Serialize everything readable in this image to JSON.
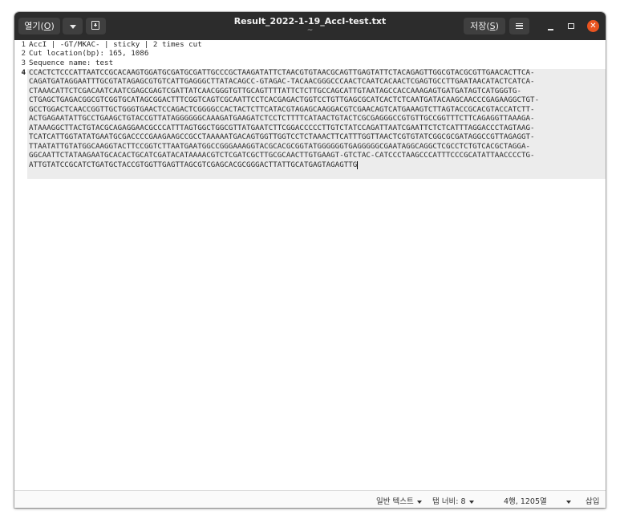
{
  "titlebar": {
    "open_label": "열기(",
    "open_key": "O",
    "open_close": ")",
    "title": "Result_2022-1-19_AccI-test.txt",
    "subtitle": "~",
    "save_label": "저장(",
    "save_key": "S",
    "save_close": ")"
  },
  "editor": {
    "line_numbers": [
      "1",
      "2",
      "3",
      "4"
    ],
    "lines": [
      "AccI | -GT/MKAC- | sticky | 2 times cut",
      "Cut location(bp): 165, 1086",
      "Sequence name: test",
      "CCACTCTCCCATTAATCCGCACAAGTGGATGCGATGCGATTGCCCGCTAAGATATTCTAACGTGTAACGCAGTTGAGTATTCTACAGAGTTGGCGTACGCGTTGAACACTTCA-",
      "CAGATGATAGGAATTTGCGTATAGAGCGTGTCATTGAGGGCTTATACAGCC-GTAGAC-TACAACGGGCCCAACTCAATCACAACTCGAGTGCCTTGAATAACATACTCATCA-",
      "CTAAACATTCTCGACAATCAATCGAGCGAGTCGATTATCAACGGGTGTTGCAGTTTTATTCTCTTGCCAGCATTGTAATAGCCACCAAAGAGTGATGATAGTCATGGGTG-",
      "CTGAGCTGAGACGGCGTCGGTGCATAGCGGACTTTCGGTCAGTCGCAATTCCTCACGAGACTGGTCCTGTTGAGCGCATCACTCTCAATGATACAAGCAACCCGAGAAGGCTGT-",
      "GCCTGGACTCAACCGGTTGCTGGGTGAACTCCAGACTCGGGGCCACTACTCTTCATACGTAGAGCAAGGACGTCGAACAGTCATGAAAGTCTTAGTACCGCACGTACCATCTT-",
      "ACTGAGAATATTGCCTGAAGCTGTACCGTTATAGGGGGGCAAAGATGAAGATCTCCTCTTTTCATAACTGTACTCGCGAGGGCCGTGTTGCCGGTTTCTTCAGAGGTTAAAGA-",
      "ATAAAGGCTTACTGTACGCAGAGGAACGCCCATTTAGTGGCTGGCGTTATGAATCTTCGGACCCCCTTGTCTATCCAGATTAATCGAATTCTCTCATTTAGGACCCTAGTAAG-",
      "TCATCATTGGTATATGAATGCGACCCCGAAGAAGCCGCCTAAAAATGACAGTGGTTGGTCCTCTAAACTTCATTTGGTTAACTCGTGTATCGGCGCGATAGGCCGTTAGAGGT-",
      "TTAATATTGTATGGCAAGGTACTTCCGGTCTTAATGAATGGCCGGGAAAGGTACGCACGCGGTATGGGGGGTGAGGGGGCGAATAGGCAGGCTCGCCTCTGTCACGCTAGGA-",
      "GGCAATTCTATAAGAATGCACACTGCATCGATACATAAAACGTCTCGATCGCTTGCGCAACTTGTGAAGT-GTCTAC-CATCCCTAAGCCCATTTCCCGCATATTAACCCCTG-",
      "ATTGTATCCGCATCTGATGCTACCGTGGTTGAGTTAGCGTCGAGCACGCGGGACTTATTGCATGAGTAGAGTTG"
    ]
  },
  "statusbar": {
    "syntax": "일반 텍스트",
    "tab_width": "탭 너비: 8",
    "position": "4행, 1205열",
    "insert_mode": "삽입"
  },
  "colors": {
    "titlebar_bg": "#2c2c2c",
    "close_button": "#e95420",
    "current_line": "#ececec"
  },
  "icons": [
    "chevron-down-icon",
    "new-document-icon",
    "hamburger-menu-icon",
    "minimize-icon",
    "maximize-icon",
    "close-icon"
  ]
}
